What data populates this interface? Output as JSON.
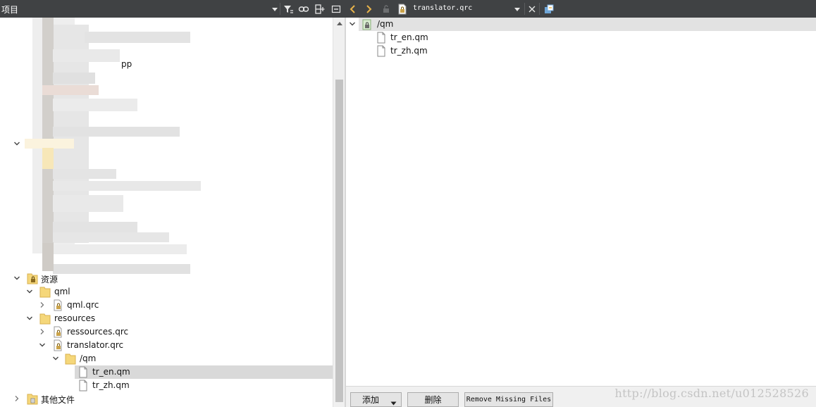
{
  "left_panel": {
    "title": "项目",
    "toolbar_icons": [
      "dropdown-arrow-icon",
      "filter-icon",
      "link-icon",
      "split-add-icon",
      "close-panel-icon"
    ]
  },
  "right_topbar": {
    "file_name": "translator.qrc",
    "icons": [
      "nav-back-icon",
      "nav-forward-icon",
      "lock-icon",
      "qrc-file-icon",
      "dropdown-arrow-icon",
      "close-icon",
      "split-view-icon"
    ]
  },
  "tree": {
    "resources_root": "资源",
    "qml_folder": "qml",
    "qml_qrc": "qml.qrc",
    "resources_folder": "resources",
    "ressources_qrc": "ressources.qrc",
    "translator_qrc": "translator.qrc",
    "qm_prefix": "/qm",
    "file_en": "tr_en.qm",
    "file_zh": "tr_zh.qm",
    "other_files": "其他文件",
    "partial_label": "pp"
  },
  "editor": {
    "prefix": "/qm",
    "files": [
      "tr_en.qm",
      "tr_zh.qm"
    ]
  },
  "bottom_bar": {
    "add_label": "添加",
    "delete_label": "删除",
    "remove_missing_label": "Remove Missing Files",
    "watermark": "http://blog.csdn.net/u012528526"
  },
  "colors": {
    "toolbar_bg": "#404244",
    "folder_yellow": "#f5d77a",
    "selection": "#d9d9d9",
    "nav_arrow": "#e8b34a"
  }
}
